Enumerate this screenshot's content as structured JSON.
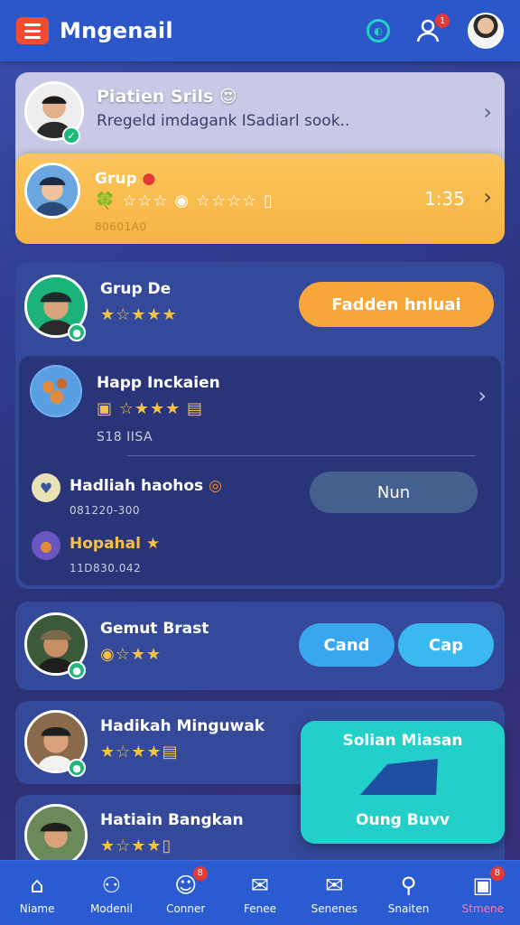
{
  "header": {
    "title": "Mngenail",
    "notif_count": "1"
  },
  "card1": {
    "name": "Piatien Srils",
    "message": "Rregeld imdagank ISadiarl sook..",
    "emoji": "😍"
  },
  "card2": {
    "name": "Grup",
    "time": "1:35",
    "meta": "80601A0"
  },
  "card3": {
    "name": "Grup De",
    "button": "Fadden hnluai"
  },
  "card3_sub": {
    "name": "Happ Inckaien",
    "meta": "S18 IISA"
  },
  "card3_row1": {
    "name": "Hadliah haohos",
    "meta": "081220-300",
    "button": "Nun"
  },
  "card3_row2": {
    "name": "Hopahal",
    "meta": "11D830.042"
  },
  "card4": {
    "name": "Gemut Brast",
    "button_left": "Cand",
    "button_right": "Cap"
  },
  "card5": {
    "name": "Hadikah Minguwak"
  },
  "card6": {
    "name": "Hatiain Bangkan"
  },
  "popup": {
    "title": "Solian Miasan",
    "footer": "Oung Buvv"
  },
  "nav": {
    "items": [
      {
        "label": "Niame",
        "badge": ""
      },
      {
        "label": "Modenil",
        "badge": ""
      },
      {
        "label": "Conner",
        "badge": "8"
      },
      {
        "label": "Fenee",
        "badge": ""
      },
      {
        "label": "Senenes",
        "badge": ""
      },
      {
        "label": "Snaiten",
        "badge": ""
      },
      {
        "label": "Stmene",
        "badge": "8"
      }
    ]
  },
  "colors": {
    "accent_orange": "#f5a53b",
    "teal": "#22d3c5",
    "nav_blue": "#2a5bd0"
  }
}
